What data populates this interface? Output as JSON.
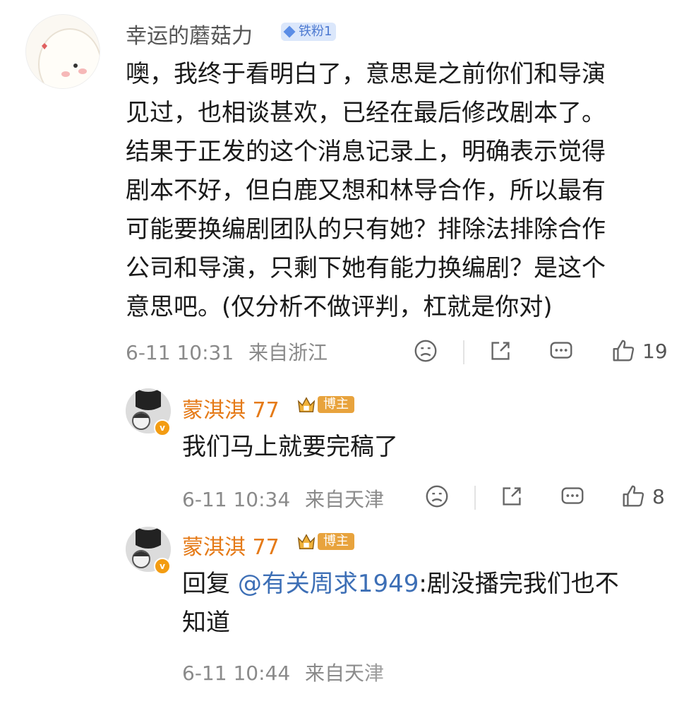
{
  "main_comment": {
    "username": "幸运的蘑菇力",
    "fan_badge": "铁粉1",
    "text": "噢，我终于看明白了，意思是之前你们和导演\n见过，也相谈甚欢，已经在最后修改剧本了。\n结果于正发的这个消息记录上，明确表示觉得\n剧本不好，但白鹿又想和林导合作，所以最有\n可能要换编剧团队的只有她？排除法排除合作\n公司和导演，只剩下她有能力换编剧？是这个\n意思吧。(仅分析不做评判，杠就是你对)",
    "time": "6-11 10:31",
    "location": "来自浙江",
    "likes": "19"
  },
  "replies": [
    {
      "username": "蒙淇淇 77",
      "role_badge": "博主",
      "text": "我们马上就要完稿了",
      "time": "6-11 10:34",
      "location": "来自天津",
      "likes": "8"
    },
    {
      "username": "蒙淇淇 77",
      "role_badge": "博主",
      "reply_prefix": "回复 ",
      "mention": "@有关周求1949",
      "text": ":剧没播完我们也不\n知道",
      "time": "6-11 10:44",
      "location": "来自天津"
    }
  ],
  "icons": [
    "dislike-icon",
    "share-icon",
    "comment-icon",
    "like-icon",
    "verified-badge-icon",
    "crown-icon",
    "diamond-icon"
  ],
  "colors": {
    "orange_name": "#e57a17",
    "mention_blue": "#3d6fb6",
    "meta_gray": "#8a8a8a",
    "fan_badge_bg": "#dbe7fb"
  }
}
